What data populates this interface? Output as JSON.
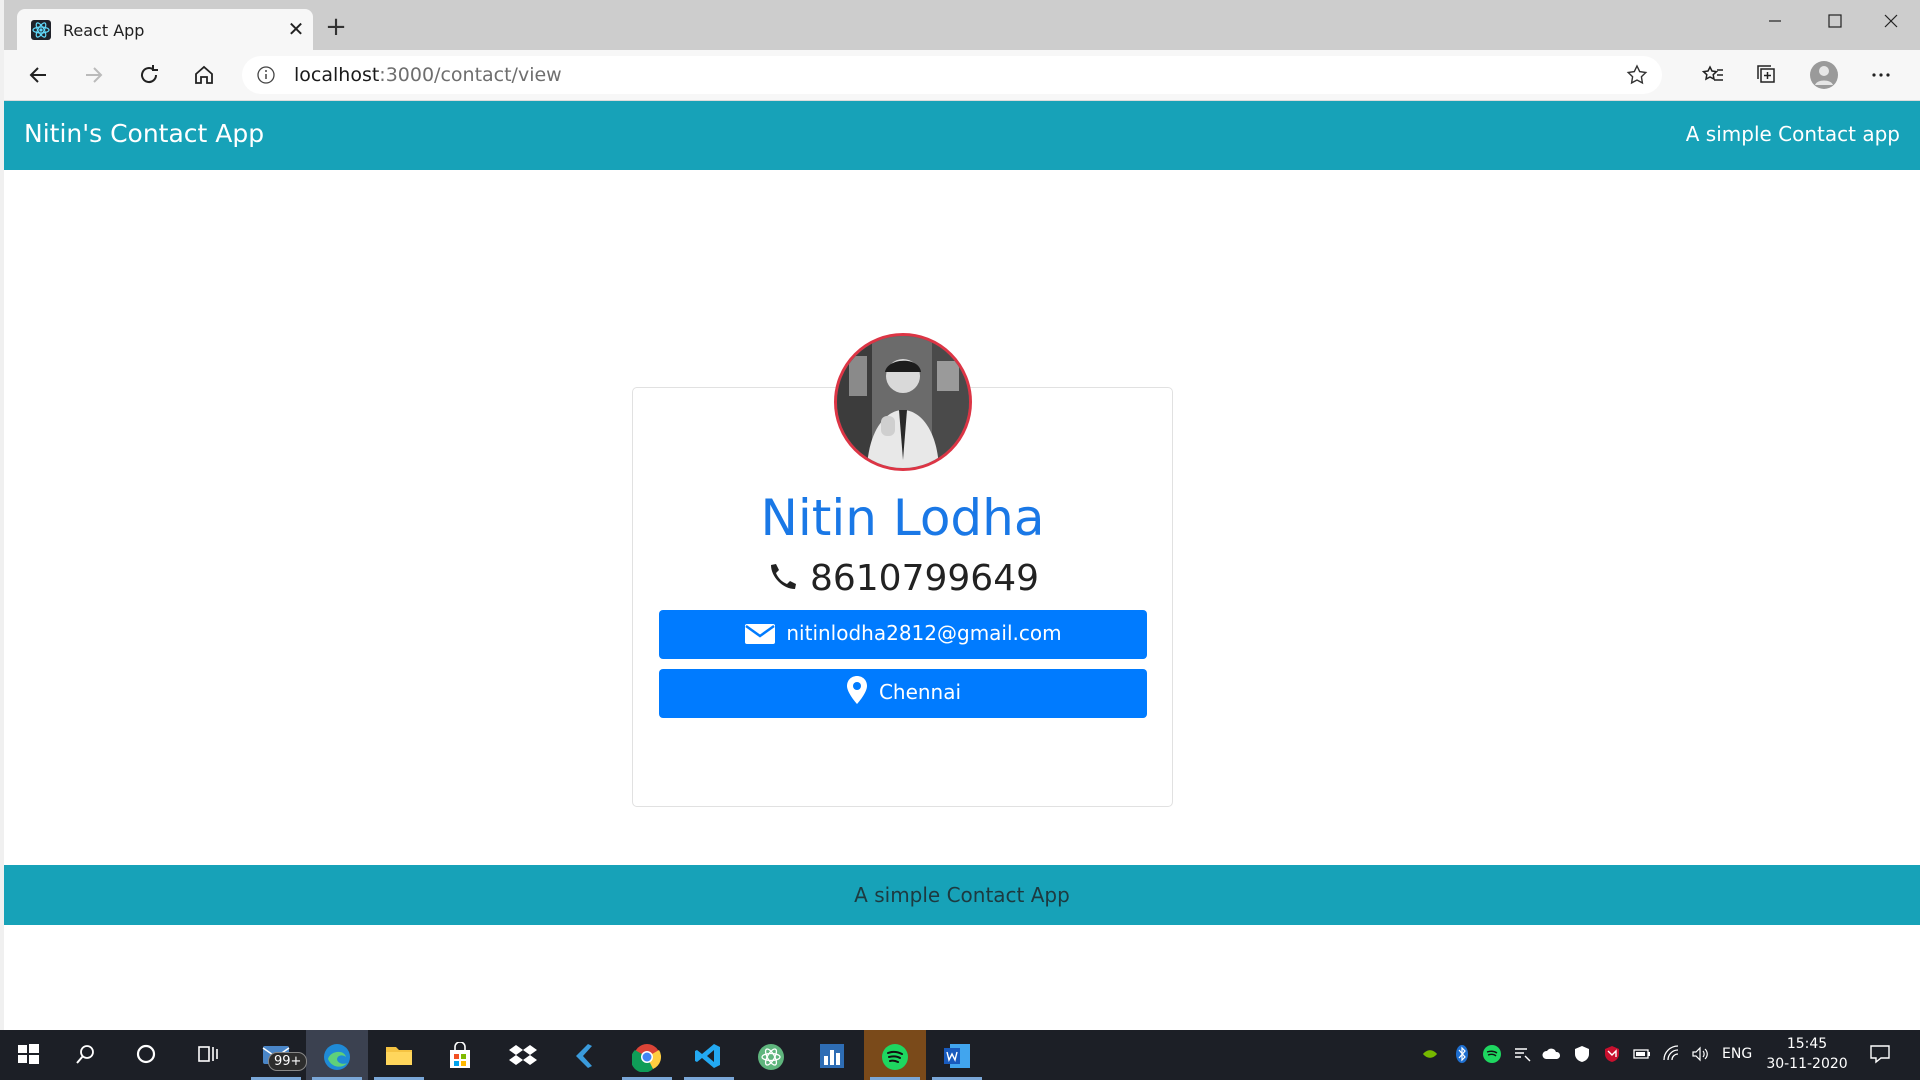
{
  "browser": {
    "tab_title": "React App",
    "url_host": "localhost",
    "url_path": ":3000/contact/view"
  },
  "app": {
    "brand": "Nitin's Contact App",
    "tagline": "A simple Contact app",
    "footer": "A simple Contact App"
  },
  "contact": {
    "name": "Nitin Lodha",
    "phone": "8610799649",
    "email": "nitinlodha2812@gmail.com",
    "city": "Chennai"
  },
  "taskbar": {
    "mail_badge": "99+",
    "language": "ENG",
    "time": "15:45",
    "date": "30-11-2020"
  },
  "colors": {
    "header_bg": "#17a2b8",
    "name_color": "#1a78e6",
    "button_bg": "#007bff",
    "avatar_border": "#dc3545"
  },
  "icons": [
    "react-icon",
    "close-icon",
    "plus-icon",
    "minimize-icon",
    "maximize-icon",
    "back-icon",
    "forward-icon",
    "refresh-icon",
    "home-icon",
    "info-icon",
    "star-icon",
    "favorites-icon",
    "collections-icon",
    "profile-icon",
    "more-icon",
    "phone-icon",
    "envelope-icon",
    "map-pin-icon",
    "windows-start-icon",
    "search-icon",
    "cortana-icon",
    "task-view-icon"
  ]
}
